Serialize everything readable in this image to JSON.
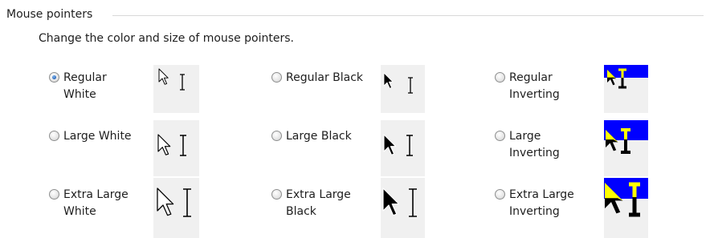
{
  "group": {
    "title": "Mouse pointers"
  },
  "description": "Change the color and size of mouse pointers.",
  "schemes": [
    {
      "label": "Regular\nWhite",
      "selected": true
    },
    {
      "label": "Regular Black",
      "selected": false
    },
    {
      "label": "Regular\nInverting",
      "selected": false
    },
    {
      "label": "Large White",
      "selected": false
    },
    {
      "label": "Large Black",
      "selected": false
    },
    {
      "label": "Large\nInverting",
      "selected": false
    },
    {
      "label": "Extra Large\nWhite",
      "selected": false
    },
    {
      "label": "Extra Large\nBlack",
      "selected": false
    },
    {
      "label": "Extra Large\nInverting",
      "selected": false
    }
  ],
  "icons": [
    "radio-button-icon",
    "arrow-pointer-icon",
    "text-select-pointer-icon"
  ],
  "colors": {
    "preview_bg": "#f0f0f0",
    "inverting_blue": "#0000ff",
    "inverting_yellow": "#ffff00",
    "radio_dot": "#2a64b8"
  }
}
